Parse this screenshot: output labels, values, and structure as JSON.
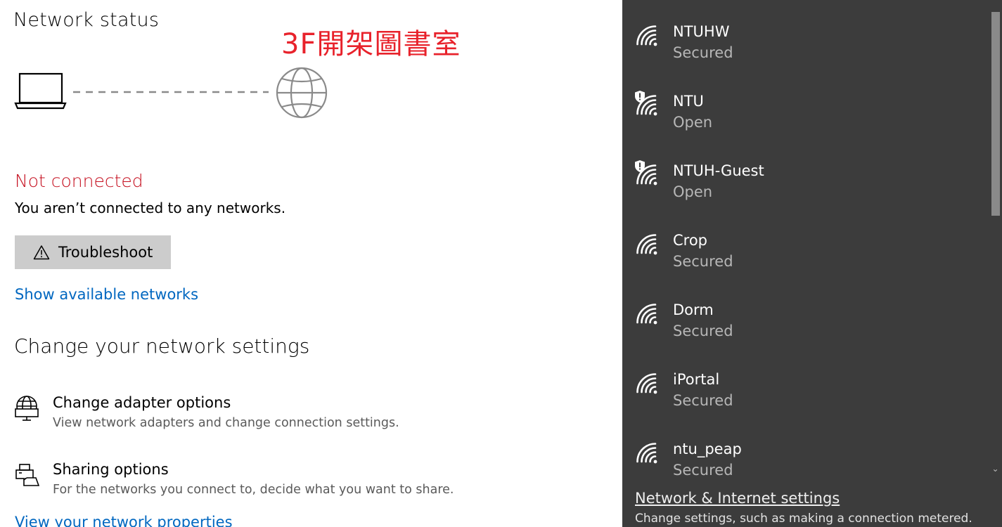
{
  "status": {
    "title": "Network status",
    "annotation": "3F開架圖書室",
    "head": "Not connected",
    "description": "You aren’t connected to any networks.",
    "troubleshoot_label": "Troubleshoot",
    "show_networks_link": "Show available networks",
    "status_color": "#c50f1f",
    "link_color": "#0067c0"
  },
  "settings": {
    "heading": "Change your network settings",
    "options": [
      {
        "title": "Change adapter options",
        "description": "View network adapters and change connection settings.",
        "icon": "adapter-icon"
      },
      {
        "title": "Sharing options",
        "description": "For the networks you connect to, decide what you want to share.",
        "icon": "sharing-icon"
      }
    ],
    "properties_link": "View your network properties"
  },
  "flyout": {
    "networks": [
      {
        "name": "NTUHW",
        "status": "Secured",
        "open": false
      },
      {
        "name": "NTU",
        "status": "Open",
        "open": true
      },
      {
        "name": "NTUH-Guest",
        "status": "Open",
        "open": true
      },
      {
        "name": "Crop",
        "status": "Secured",
        "open": false
      },
      {
        "name": "Dorm",
        "status": "Secured",
        "open": false
      },
      {
        "name": "iPortal",
        "status": "Secured",
        "open": false
      },
      {
        "name": "ntu_peap",
        "status": "Secured",
        "open": false
      }
    ],
    "settings_link": "Network & Internet settings",
    "settings_desc": "Change settings, such as making a connection metered.",
    "background": "#3c3c3c"
  }
}
